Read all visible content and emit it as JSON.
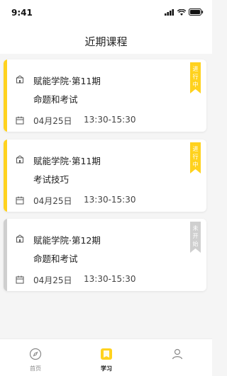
{
  "status_bar": {
    "time": "9:41"
  },
  "nav": {
    "title": "近期课程"
  },
  "colors": {
    "active": "#ffd21e",
    "inactive": "#cfcfcf"
  },
  "courses": [
    {
      "title": "赋能学院·第11期",
      "subtitle": "命题和考试",
      "date": "04月25日",
      "time": "13:30-15:30",
      "status": "进行中"
    },
    {
      "title": "赋能学院·第11期",
      "subtitle": "考试技巧",
      "date": "04月25日",
      "time": "13:30-15:30",
      "status": "进行中"
    },
    {
      "title": "赋能学院·第12期",
      "subtitle": "命题和考试",
      "date": "04月25日",
      "time": "13:30-15:30",
      "status": "未开始"
    }
  ],
  "tabs": [
    {
      "label": "首页",
      "icon": "compass-icon"
    },
    {
      "label": "学习",
      "icon": "book-icon"
    },
    {
      "label": "",
      "icon": "profile-icon"
    }
  ]
}
